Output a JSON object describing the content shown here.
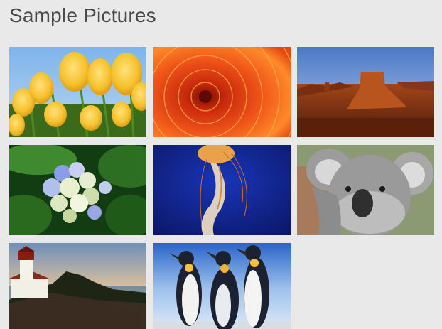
{
  "header": {
    "title": "Sample Pictures"
  },
  "pictures": [
    {
      "name": "tulips"
    },
    {
      "name": "chrysanthemum"
    },
    {
      "name": "desert"
    },
    {
      "name": "hydrangeas"
    },
    {
      "name": "jellyfish"
    },
    {
      "name": "koala"
    },
    {
      "name": "lighthouse"
    },
    {
      "name": "penguins"
    }
  ]
}
